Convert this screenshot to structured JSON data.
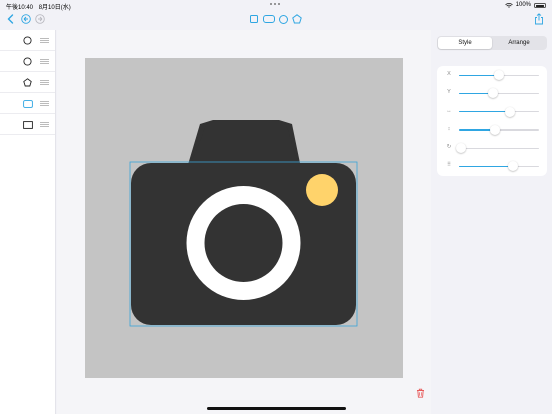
{
  "status_bar": {
    "time": "午後10:40",
    "date": "8月10日(水)",
    "battery_percent": "100%"
  },
  "toolbar": {
    "back_icon": "chevron-left-icon",
    "undo_icon": "undo-icon",
    "redo_icon": "redo-icon",
    "add_shapes": [
      {
        "name": "add-rectangle",
        "icon": "rectangle-icon"
      },
      {
        "name": "add-rounded-rectangle",
        "icon": "rounded-rectangle-icon"
      },
      {
        "name": "add-circle",
        "icon": "circle-icon"
      },
      {
        "name": "add-pentagon",
        "icon": "pentagon-icon"
      }
    ],
    "share_icon": "share-icon"
  },
  "layers": [
    {
      "shape": "circle",
      "icon": "circle-icon"
    },
    {
      "shape": "circle",
      "icon": "circle-icon"
    },
    {
      "shape": "pentagon",
      "icon": "pentagon-icon"
    },
    {
      "shape": "rectangle-selected",
      "icon": "rectangle-icon",
      "selected": true
    },
    {
      "shape": "rectangle",
      "icon": "rectangle-icon"
    }
  ],
  "inspector": {
    "tabs": [
      {
        "label": "Style",
        "active": true
      },
      {
        "label": "Arrange",
        "active": false
      }
    ],
    "sliders": [
      {
        "name": "x",
        "label": "X",
        "value": 0.5
      },
      {
        "name": "y",
        "label": "Y",
        "value": 0.43
      },
      {
        "name": "width",
        "label": "↔",
        "value": 0.64
      },
      {
        "name": "height",
        "label": "↕",
        "value": 0.45
      },
      {
        "name": "rotation",
        "label": "↻",
        "value": 0.03
      },
      {
        "name": "corner-radius",
        "label": "⠿",
        "value": 0.68
      }
    ]
  },
  "colors": {
    "accent": "#2fa6e2",
    "canvas_bg": "#c4c4c4",
    "camera_body": "#333333",
    "lens_ring": "#ffffff",
    "flash": "#ffd36b"
  }
}
